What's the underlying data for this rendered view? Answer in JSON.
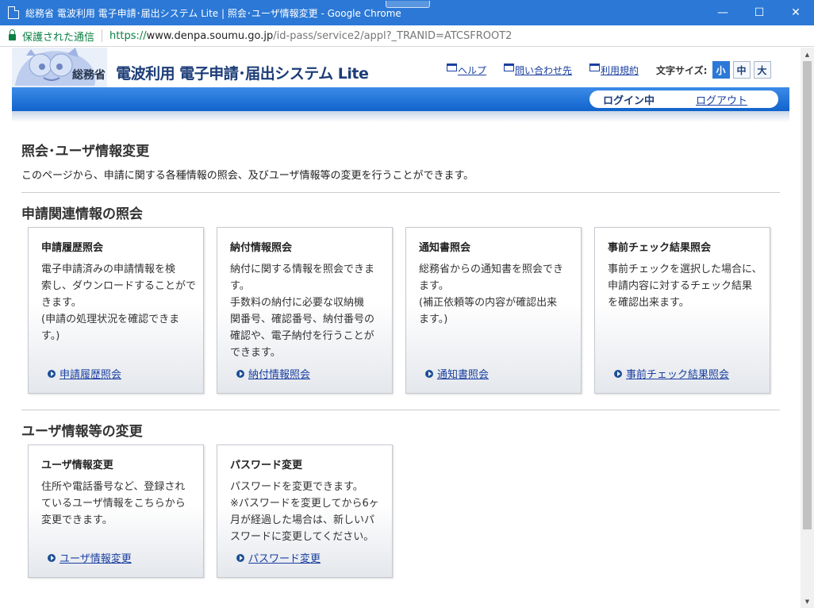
{
  "window": {
    "title": "総務省 電波利用 電子申請･届出システム Lite | 照会･ユーザ情報変更 - Google Chrome",
    "minimize": "—",
    "maximize": "☐",
    "close": "✕"
  },
  "address": {
    "secure_label": "保護された通信",
    "scheme": "https://",
    "host": "www.denpa.soumu.go.jp",
    "path": "/id-pass/service2/appl?_TRANID=ATCSFROOT2"
  },
  "header": {
    "ministry": "総務省",
    "system_name": "電波利用 電子申請･届出システム Lite",
    "links": [
      {
        "label": "ヘルプ"
      },
      {
        "label": "問い合わせ先"
      },
      {
        "label": "利用規約"
      }
    ],
    "fontsize_label": "文字サイズ:",
    "fontsize_options": [
      "小",
      "中",
      "大"
    ],
    "login_status": "ログイン中",
    "logout": "ログアウト"
  },
  "main": {
    "title": "照会･ユーザ情報変更",
    "description": "このページから、申請に関する各種情報の照会、及びユーザ情報等の変更を行うことができます。",
    "sections": [
      {
        "title": "申請関連情報の照会",
        "cards": [
          {
            "title": "申請履歴照会",
            "description": "電子申請済みの申請情報を検\n索し、ダウンロードすることがで\nきます。\n(申請の処理状況を確認できま\nす。)",
            "link": "申請履歴照会"
          },
          {
            "title": "納付情報照会",
            "description": "納付に関する情報を照会できま\nす。\n手数料の納付に必要な収納機\n関番号、確認番号、納付番号の\n確認や、電子納付を行うことが\nできます。",
            "link": "納付情報照会"
          },
          {
            "title": "通知書照会",
            "description": "総務省からの通知書を照会でき\nます。\n(補正依頼等の内容が確認出来\nます。)",
            "link": "通知書照会"
          },
          {
            "title": "事前チェック結果照会",
            "description": "事前チェックを選択した場合に、\n申請内容に対するチェック結果\nを確認出来ます。",
            "link": "事前チェック結果照会"
          }
        ]
      },
      {
        "title": "ユーザ情報等の変更",
        "cards": [
          {
            "title": "ユーザ情報変更",
            "description": "住所や電話番号など、登録され\nているユーザ情報をこちらから\n変更できます。",
            "link": "ユーザ情報変更"
          },
          {
            "title": "パスワード変更",
            "description": "パスワードを変更できます。\n※パスワードを変更してから6ヶ\n月が経過した場合は、新しいパ\nスワードに変更してください。",
            "link": "パスワード変更"
          }
        ]
      }
    ]
  },
  "colors": {
    "titlebar": "#2b78d6",
    "header_bar": "#1163cc",
    "link": "#1a3fa0",
    "secure": "#0b8043"
  }
}
